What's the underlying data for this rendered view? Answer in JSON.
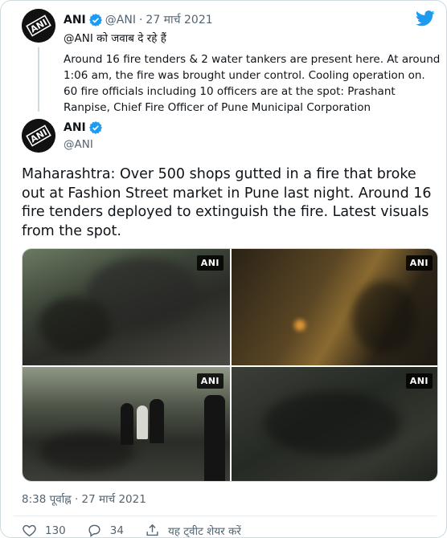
{
  "quoted_tweet": {
    "author_name": "ANI",
    "handle": "@ANI",
    "separator": "·",
    "date": "27 मार्च 2021",
    "replying_to": "@ANI को जवाब दे रहे हैं",
    "text": "Around 16 fire tenders & 2 water tankers are present here. At around 1:06 am, the fire was brought under control. Cooling operation on. 60 fire officials including 10 officers are at the spot: Prashant Ranpise, Chief Fire Officer of Pune Municipal Corporation"
  },
  "main_tweet": {
    "author_name": "ANI",
    "handle": "@ANI",
    "text": "Maharashtra: Over 500 shops gutted in a fire that broke out at Fashion Street market in Pune last night. Around 16 fire tenders deployed to extinguish the fire. Latest visuals from the spot.",
    "timestamp": "8:38 पूर्वाह्न · 27 मार्च 2021",
    "media_watermarks": [
      "ANI",
      "ANI",
      "ANI",
      "ANI"
    ]
  },
  "avatar_label": "ANI",
  "actions": {
    "likes": "130",
    "replies": "34",
    "share_label": "यह ट्वीट शेयर करें"
  },
  "icons": {
    "brand": "twitter-bird-icon",
    "verified": "verified-badge-icon",
    "like": "heart-icon",
    "reply": "reply-bubble-icon",
    "share": "share-icon"
  },
  "colors": {
    "twitter_blue": "#1d9bf0",
    "text": "#0f1419",
    "muted": "#536471",
    "border": "#cfd9de"
  }
}
